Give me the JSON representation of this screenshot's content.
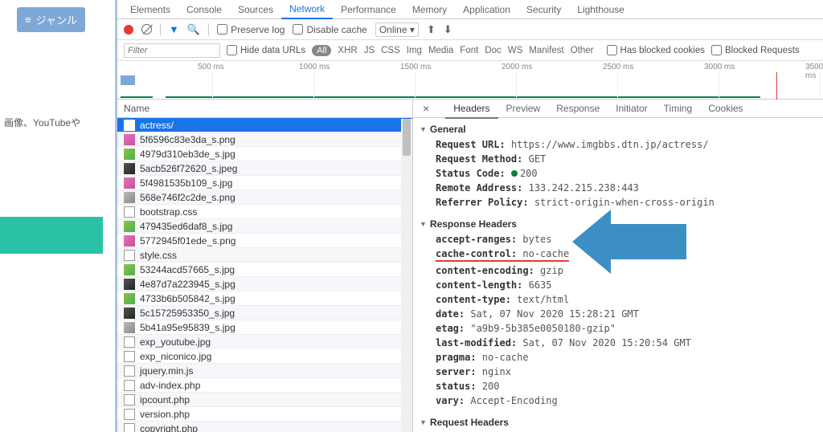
{
  "leftEdge": {
    "genreLabel": "ジャンル",
    "sideText": "画像、YouTubeや"
  },
  "panelTabs": [
    "Elements",
    "Console",
    "Sources",
    "Network",
    "Performance",
    "Memory",
    "Application",
    "Security",
    "Lighthouse"
  ],
  "panelActive": "Network",
  "toolbar": {
    "preserveLog": "Preserve log",
    "disableCache": "Disable cache",
    "online": "Online"
  },
  "filterbar": {
    "filterPlaceholder": "Filter",
    "hideData": "Hide data URLs",
    "all": "All",
    "types": [
      "XHR",
      "JS",
      "CSS",
      "Img",
      "Media",
      "Font",
      "Doc",
      "WS",
      "Manifest",
      "Other"
    ],
    "hasBlocked": "Has blocked cookies",
    "blockedReq": "Blocked Requests"
  },
  "timeline": {
    "labels": [
      "500 ms",
      "1000 ms",
      "1500 ms",
      "2000 ms",
      "2500 ms",
      "3000 ms",
      "3500 ms"
    ]
  },
  "reqHeader": "Name",
  "requests": [
    {
      "name": "actress/",
      "icon": "doc",
      "selected": true
    },
    {
      "name": "5f6596c83e3da_s.png",
      "icon": "imgp"
    },
    {
      "name": "4979d310eb3de_s.jpg",
      "icon": "img"
    },
    {
      "name": "5acb526f72620_s.jpeg",
      "icon": "imgb"
    },
    {
      "name": "5f4981535b109_s.jpg",
      "icon": "imgp"
    },
    {
      "name": "568e746f2c2de_s.png",
      "icon": "imgg"
    },
    {
      "name": "bootstrap.css",
      "icon": "doc"
    },
    {
      "name": "479435ed6daf8_s.jpg",
      "icon": "img"
    },
    {
      "name": "5772945f01ede_s.png",
      "icon": "imgp"
    },
    {
      "name": "style.css",
      "icon": "doc"
    },
    {
      "name": "53244acd57665_s.jpg",
      "icon": "img"
    },
    {
      "name": "4e87d7a223945_s.jpg",
      "icon": "imgb"
    },
    {
      "name": "4733b6b505842_s.jpg",
      "icon": "img"
    },
    {
      "name": "5c15725953350_s.jpg",
      "icon": "imgb"
    },
    {
      "name": "5b41a95e95839_s.jpg",
      "icon": "imgg"
    },
    {
      "name": "exp_youtube.jpg",
      "icon": "doc"
    },
    {
      "name": "exp_niconico.jpg",
      "icon": "doc"
    },
    {
      "name": "jquery.min.js",
      "icon": "doc"
    },
    {
      "name": "adv-index.php",
      "icon": "doc"
    },
    {
      "name": "ipcount.php",
      "icon": "doc"
    },
    {
      "name": "version.php",
      "icon": "doc"
    },
    {
      "name": "copyright.php",
      "icon": "doc"
    }
  ],
  "detailTabs": [
    "Headers",
    "Preview",
    "Response",
    "Initiator",
    "Timing",
    "Cookies"
  ],
  "detailActive": "Headers",
  "general": {
    "title": "General",
    "url_k": "Request URL:",
    "url_v": "https://www.imgbbs.dtn.jp/actress/",
    "method_k": "Request Method:",
    "method_v": "GET",
    "status_k": "Status Code:",
    "status_v": "200",
    "remote_k": "Remote Address:",
    "remote_v": "133.242.215.238:443",
    "refpol_k": "Referrer Policy:",
    "refpol_v": "strict-origin-when-cross-origin"
  },
  "respHeaders": {
    "title": "Response Headers",
    "items": [
      {
        "k": "accept-ranges:",
        "v": "bytes"
      },
      {
        "k": "cache-control:",
        "v": "no-cache",
        "highlight": true
      },
      {
        "k": "content-encoding:",
        "v": "gzip"
      },
      {
        "k": "content-length:",
        "v": "6635"
      },
      {
        "k": "content-type:",
        "v": "text/html"
      },
      {
        "k": "date:",
        "v": "Sat, 07 Nov 2020 15:28:21 GMT"
      },
      {
        "k": "etag:",
        "v": "\"a9b9-5b385e0050180-gzip\""
      },
      {
        "k": "last-modified:",
        "v": "Sat, 07 Nov 2020 15:20:54 GMT"
      },
      {
        "k": "pragma:",
        "v": "no-cache"
      },
      {
        "k": "server:",
        "v": "nginx"
      },
      {
        "k": "status:",
        "v": "200"
      },
      {
        "k": "vary:",
        "v": "Accept-Encoding"
      }
    ]
  },
  "reqHeadersTitle": "Request Headers"
}
